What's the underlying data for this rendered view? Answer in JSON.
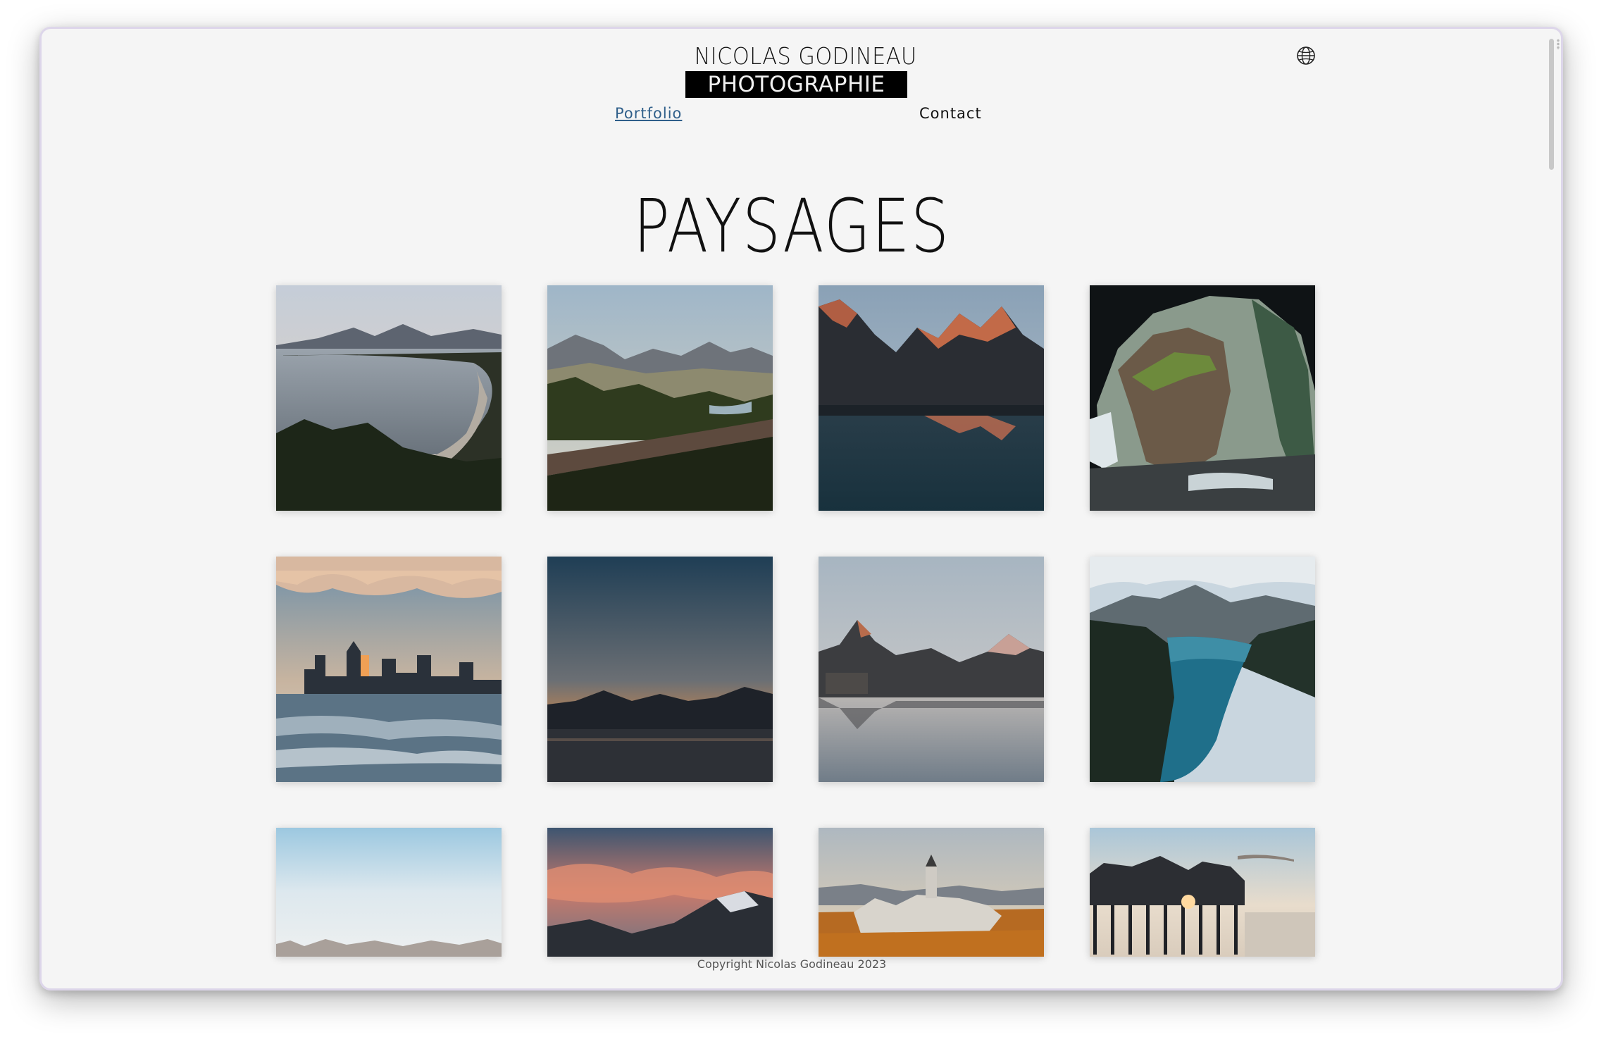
{
  "header": {
    "logo_line1": "NICOLAS GODINEAU",
    "logo_line2": "PHOTOGRAPHIE",
    "language_icon": "globe-icon"
  },
  "nav": {
    "items": [
      {
        "label": "Portfolio",
        "active": true
      },
      {
        "label": "Contact",
        "active": false
      }
    ],
    "active_color": "#2f5f8a"
  },
  "main": {
    "title": "PAYSAGES",
    "gallery": [
      {
        "subject": "coastal beach with mountains at dusk"
      },
      {
        "subject": "mountain valley with forest and river"
      },
      {
        "subject": "alpenglow peaks reflected in lake"
      },
      {
        "subject": "cave opening with rock and waterfall"
      },
      {
        "subject": "city skyline at sunset over icy river"
      },
      {
        "subject": "mountain silhouette at twilight over lake"
      },
      {
        "subject": "mountain lake reflection with lodge"
      },
      {
        "subject": "turquoise glacial lake between mountains"
      },
      {
        "subject": "misty sky over treeline"
      },
      {
        "subject": "pink sunset clouds over snowy mountains"
      },
      {
        "subject": "church among autumn trees"
      },
      {
        "subject": "pier houses at sunset on the beach"
      }
    ]
  },
  "footer": {
    "copyright": "Copyright Nicolas Godineau 2023"
  },
  "colors": {
    "background": "#f5f5f5",
    "text": "#111111",
    "logo_box": "#000000"
  }
}
